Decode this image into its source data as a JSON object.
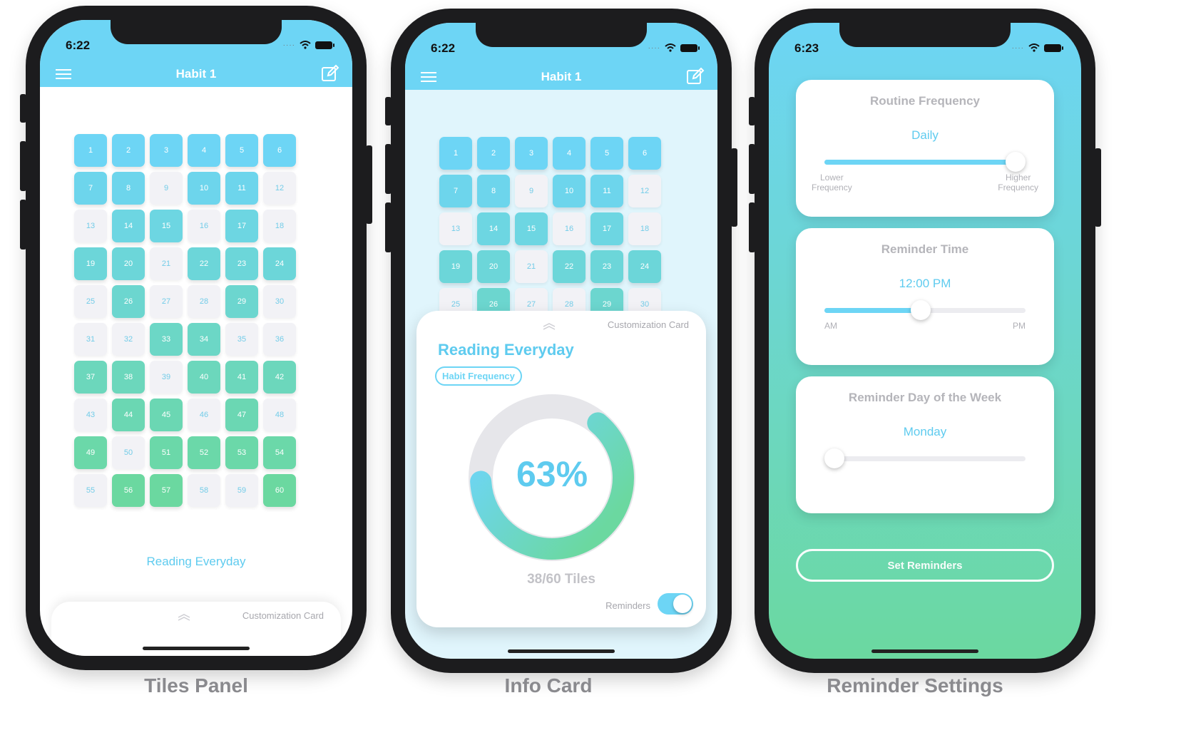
{
  "phones": [
    {
      "caption": "Tiles Panel",
      "status_time": "6:22",
      "nav_title": "Habit 1",
      "habit_name": "Reading Everyday",
      "card_label": "Customization Card"
    },
    {
      "caption": "Info Card",
      "status_time": "6:22",
      "nav_title": "Habit 1",
      "info": {
        "title": "Reading Everyday",
        "pill": "Habit Frequency",
        "percent": "63%",
        "percent_value": 0.63,
        "tiles_count": "38/60 Tiles",
        "reminders_label": "Reminders",
        "reminders_on": true,
        "card_label": "Customization Card"
      }
    },
    {
      "caption": "Reminder Settings",
      "status_time": "6:23",
      "cards": [
        {
          "title": "Routine Frequency",
          "value": "Daily",
          "level": 0.95,
          "min_label": "Lower\nFrequency",
          "max_label": "Higher\nFrequency"
        },
        {
          "title": "Reminder Time",
          "value": "12:00 PM",
          "level": 0.48,
          "min_label": "AM",
          "max_label": "PM"
        },
        {
          "title": "Reminder Day of the Week",
          "value": "Monday",
          "level": 0.05,
          "min_label": "",
          "max_label": ""
        }
      ],
      "button": "Set Reminders"
    }
  ],
  "tiles": {
    "count": 60,
    "filled": [
      1,
      2,
      3,
      4,
      5,
      6,
      7,
      8,
      10,
      11,
      14,
      15,
      17,
      19,
      20,
      22,
      23,
      24,
      26,
      29,
      33,
      34,
      37,
      38,
      40,
      41,
      42,
      44,
      45,
      47,
      49,
      51,
      52,
      53,
      54,
      56,
      57,
      60
    ],
    "color_top": "#6dd5f5",
    "color_bottom": "#6bd8a0"
  },
  "colors": {
    "accent": "#6dd5f5",
    "green": "#6bd8a0",
    "empty_tile": "#f2f2f6"
  }
}
